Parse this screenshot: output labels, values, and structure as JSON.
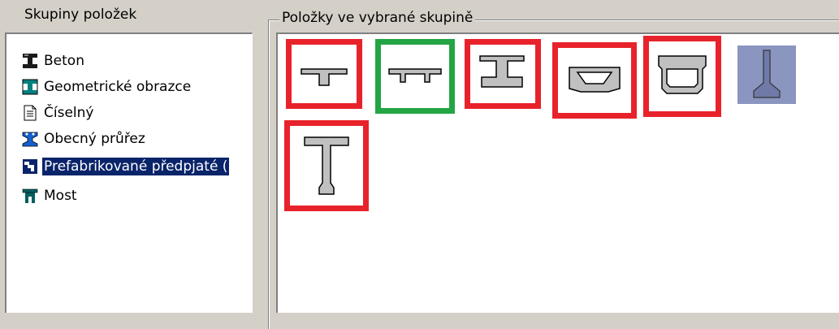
{
  "left_panel": {
    "title": "Skupiny položek",
    "items": [
      {
        "label": "Beton",
        "icon": "beton-icon"
      },
      {
        "label": "Geometrické obrazce",
        "icon": "geometric-icon"
      },
      {
        "label": "Číselný",
        "icon": "document-icon"
      },
      {
        "label": "Obecný průřez",
        "icon": "general-section-icon"
      },
      {
        "label": "Prefabrikované předpjaté (",
        "icon": "prefab-icon",
        "selected": true
      },
      {
        "label": "Most",
        "icon": "bridge-icon"
      }
    ]
  },
  "right_panel": {
    "title": "Položky ve vybrané skupině",
    "items": [
      {
        "name": "t-beam-section",
        "highlight": "red"
      },
      {
        "name": "double-t-section",
        "highlight": "green"
      },
      {
        "name": "i-beam-section",
        "highlight": "red"
      },
      {
        "name": "trapezoid-box-section",
        "highlight": "red"
      },
      {
        "name": "box-girder-section",
        "highlight": "red"
      },
      {
        "name": "inverted-t-section",
        "highlight": "none"
      },
      {
        "name": "tall-i-beam-section",
        "highlight": "red"
      }
    ]
  },
  "colors": {
    "selection": "#0a246a",
    "highlight_red": "#e8222b",
    "highlight_green": "#23a544",
    "window_bg": "#d4d0c8"
  }
}
